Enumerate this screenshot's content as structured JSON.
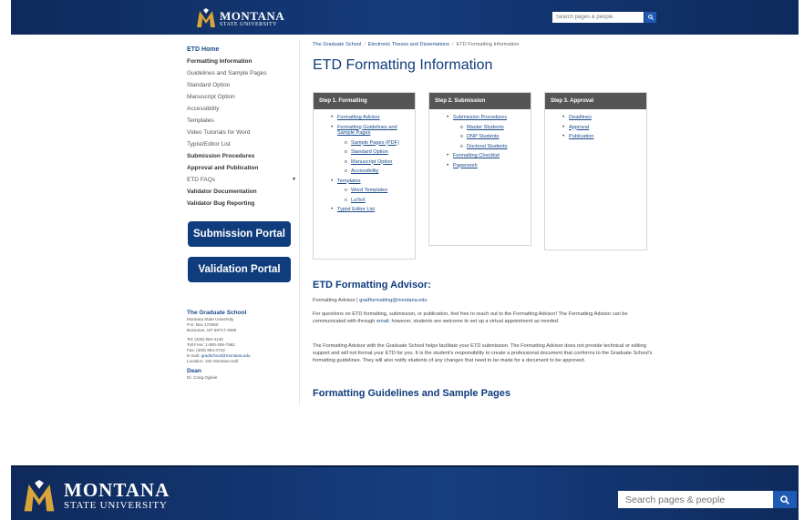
{
  "header": {
    "logo_line1": "MONTANA",
    "logo_line2": "STATE UNIVERSITY",
    "search_placeholder": "Search pages & people"
  },
  "sidebar": {
    "items": [
      {
        "label": "ETD Home",
        "style": "home"
      },
      {
        "label": "Formatting Information",
        "style": "bold"
      },
      {
        "label": "Guidelines and Sample Pages",
        "style": "normal"
      },
      {
        "label": "Standard Option",
        "style": "normal"
      },
      {
        "label": "Manuscript Option",
        "style": "normal"
      },
      {
        "label": "Accessibility",
        "style": "normal"
      },
      {
        "label": "Templates",
        "style": "normal"
      },
      {
        "label": "Video Tutorials for Word",
        "style": "normal"
      },
      {
        "label": "Typist/Editor List",
        "style": "normal"
      },
      {
        "label": "Submission Procedures",
        "style": "bold"
      },
      {
        "label": "Approval and Publication",
        "style": "bold"
      },
      {
        "label": "ETD FAQs",
        "style": "normal"
      },
      {
        "label": "Validator Documentation",
        "style": "bold"
      },
      {
        "label": "Validator Bug Reporting",
        "style": "bold"
      }
    ],
    "submission_portal": "Submission Portal",
    "validation_portal": "Validation Portal"
  },
  "contact": {
    "org": "The Graduate School",
    "lines": [
      "Montana State University",
      "P.O. Box 172580",
      "Bozeman, MT 59717-2580"
    ],
    "tel": "Tel: (406) 994-4145",
    "tollfree": "Toll Free: 1-800-255-7962",
    "fax": "Fax: (406) 994-4733",
    "email_label": "E-mail: ",
    "email": "gradschool@montana.edu",
    "location": "Location: 104 Montana Hall",
    "dean_title": "Dean",
    "dean_name": "Dr. Craig Ogilvie"
  },
  "breadcrumb": {
    "items": [
      "The Graduate School",
      "Electronic Theses and Dissertations",
      "ETD Formatting Information"
    ],
    "sep": "/"
  },
  "main": {
    "title": "ETD Formatting Information",
    "steps": [
      {
        "heading": "Step 1. Formatting",
        "items": [
          {
            "label": "Formatting Advisor",
            "level": 1
          },
          {
            "label": "Formatting Guidelines and Sample Pages",
            "level": 1
          },
          {
            "label": "Sample Pages (PDF)",
            "level": 2
          },
          {
            "label": "Standard Option",
            "level": 2
          },
          {
            "label": "Manuscript Option",
            "level": 2
          },
          {
            "label": "Accessibility",
            "level": 2
          },
          {
            "label": "Templates",
            "level": 1
          },
          {
            "label": "Word Templates",
            "level": 2
          },
          {
            "label": "LaTeX",
            "level": 2
          },
          {
            "label": "Typist Editor List",
            "level": 1
          }
        ]
      },
      {
        "heading": "Step 2. Submission",
        "items": [
          {
            "label": "Submission Procedures",
            "level": 1
          },
          {
            "label": "Master Students",
            "level": 2
          },
          {
            "label": "DNP Students",
            "level": 2
          },
          {
            "label": "Doctoral Students",
            "level": 2
          },
          {
            "label": "Formatting Checklist",
            "level": 1
          },
          {
            "label": "Paperwork",
            "level": 1
          }
        ]
      },
      {
        "heading": "Step 3. Approval",
        "items": [
          {
            "label": "Deadlines",
            "level": 1
          },
          {
            "label": "Approval",
            "level": 1
          },
          {
            "label": "Publication",
            "level": 1
          }
        ]
      }
    ],
    "advisor_heading": "ETD Formatting Advisor:",
    "advisor_line_prefix": "Formatting Advisor | ",
    "advisor_email": "gradformatting@montana.edu",
    "para1_a": "For questions on ETD formatting, submission, or publication, feel free to reach out to the Formatting Advisor! The Formatting Advisor can be communicated with through ",
    "para1_link": "email",
    "para1_b": "; however, students are welcome to set up a virtual appointment as needed.",
    "para2": "The Formatting Advisor with the Graduate School helps facilitate your ETD submission. The Formatting Advisor does not provide technical or editing support and will not format your ETD for you. It is the student's responsibility to create a professional document that conforms to the Graduate School's formatting guidelines. They will also notify students of any changes that need to be made for a document to be approved.",
    "guidelines_heading": "Formatting Guidelines and Sample Pages"
  },
  "footer": {
    "logo_line1": "MONTANA",
    "logo_line2": "STATE UNIVERSITY",
    "search_placeholder": "Search pages & people"
  },
  "colors": {
    "brand_navy": "#0f2a5c",
    "accent_blue": "#1f5bb5",
    "link_blue": "#1a4a8a",
    "portal_button": "#0f3c7c",
    "step_header": "#555555",
    "logo_gold": "#d9a53a"
  },
  "icons": {
    "search": "search-icon",
    "logo": "msu-m-logo-icon",
    "caret": "caret-down-icon"
  }
}
